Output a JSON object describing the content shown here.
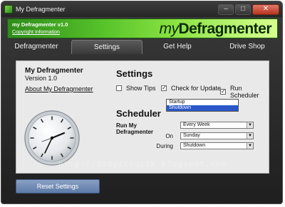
{
  "window": {
    "title": "My Defragmenter",
    "min": "–",
    "max": "□",
    "close": "✕"
  },
  "banner": {
    "version": "my Defragmenter v1.0",
    "copyright": "Copyright Information",
    "brand_prefix": "my",
    "brand_name": "Defragmenter"
  },
  "tabs": [
    {
      "label": "Defragmenter",
      "active": false
    },
    {
      "label": "Settings",
      "active": true
    },
    {
      "label": "Get Help",
      "active": false
    },
    {
      "label": "Drive Shop",
      "active": false
    }
  ],
  "about": {
    "title": "My Defragmenter",
    "version": "Version 1.0",
    "link": "About My Defragmenter"
  },
  "settings": {
    "heading": "Settings",
    "options": [
      {
        "label": "Show Tips",
        "checked": false
      },
      {
        "label": "Check for Update",
        "checked": true
      },
      {
        "label": "Run Scheduler",
        "checked": true
      }
    ]
  },
  "scheduler": {
    "heading": "Scheduler",
    "run_label": "Run My Defragmenter",
    "run_value": "Every Week",
    "on_label": "On",
    "on_value": "Sunday",
    "during_label": "During",
    "during_value": "Shutdown",
    "during_options": [
      "Startup",
      "Shutdown"
    ]
  },
  "reset_button": "Reset Settings",
  "watermark": "http://Qadyitzuczk.blogspot.com"
}
